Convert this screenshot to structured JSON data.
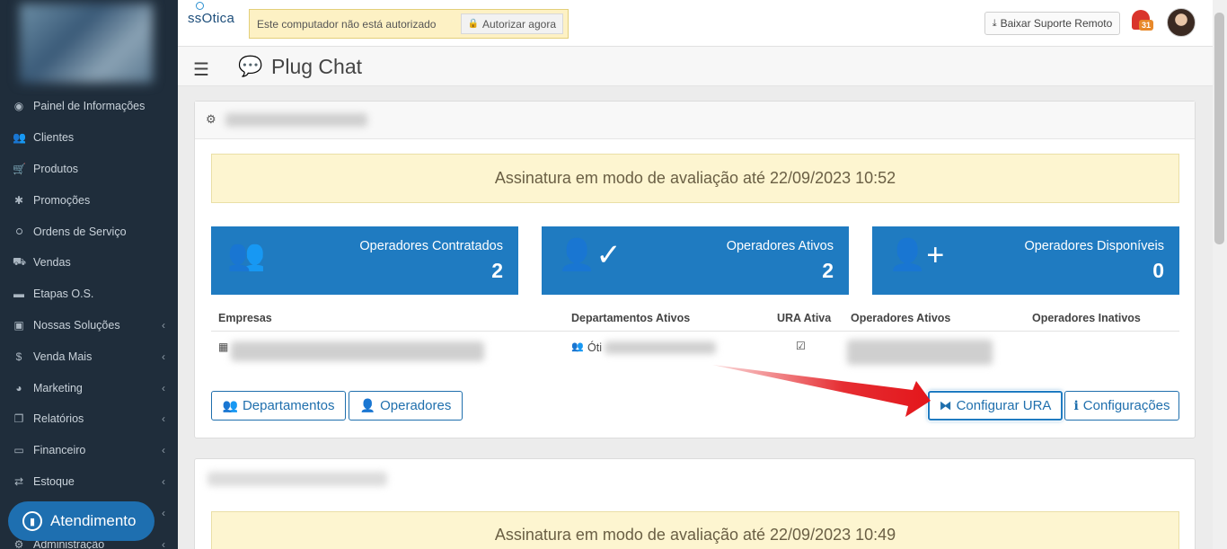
{
  "sidebar": {
    "items": [
      {
        "label": "Painel de Informações",
        "icon": "dashboard-icon",
        "glyph": "◉",
        "chevron": false
      },
      {
        "label": "Clientes",
        "icon": "users-icon",
        "glyph": "👥",
        "chevron": false
      },
      {
        "label": "Produtos",
        "icon": "cart-icon",
        "glyph": "🛒",
        "chevron": false
      },
      {
        "label": "Promoções",
        "icon": "asterisk-icon",
        "glyph": "✱",
        "chevron": false
      },
      {
        "label": "Ordens de Serviço",
        "icon": "glasses-icon",
        "glyph": "ഠ",
        "chevron": false
      },
      {
        "label": "Vendas",
        "icon": "basket-icon",
        "glyph": "⛟",
        "chevron": false
      },
      {
        "label": "Etapas O.S.",
        "icon": "steps-icon",
        "glyph": "▬",
        "chevron": false
      },
      {
        "label": "Nossas Soluções",
        "icon": "briefcase-icon",
        "glyph": "▣",
        "chevron": true
      },
      {
        "label": "Venda Mais",
        "icon": "dollar-icon",
        "glyph": "$",
        "chevron": true
      },
      {
        "label": "Marketing",
        "icon": "comments-icon",
        "glyph": "◕",
        "chevron": true
      },
      {
        "label": "Relatórios",
        "icon": "copy-icon",
        "glyph": "❐",
        "chevron": true
      },
      {
        "label": "Financeiro",
        "icon": "money-icon",
        "glyph": "▭",
        "chevron": true
      },
      {
        "label": "Estoque",
        "icon": "exchange-icon",
        "glyph": "⇄",
        "chevron": true
      },
      {
        "label": "",
        "icon": "hidden-icon",
        "glyph": "",
        "chevron": true
      },
      {
        "label": "Administração",
        "icon": "cog-icon",
        "glyph": "⚙",
        "chevron": true
      }
    ],
    "chevron_glyph": "‹",
    "atendimento_label": "Atendimento"
  },
  "topbar": {
    "brand": "ssOtica",
    "alert_text": "Este computador não está autorizado",
    "authorize_label": "Autorizar agora",
    "download_label": "Baixar Suporte Remoto",
    "notification_count": "31"
  },
  "page": {
    "title": "Plug Chat"
  },
  "card": {
    "trial_text": "Assinatura em modo de avaliação até 22/09/2023 10:52",
    "stats": [
      {
        "label": "Operadores Contratados",
        "value": "2",
        "icon": "users-group-icon"
      },
      {
        "label": "Operadores Ativos",
        "value": "2",
        "icon": "user-check-icon"
      },
      {
        "label": "Operadores Disponíveis",
        "value": "0",
        "icon": "user-plus-icon"
      }
    ],
    "table": {
      "headers": [
        "Empresas",
        "Departamentos Ativos",
        "URA Ativa",
        "Operadores Ativos",
        "Operadores Inativos"
      ],
      "row": {
        "departamento": "Óti"
      }
    },
    "buttons": {
      "departamentos": "Departamentos",
      "operadores": "Operadores",
      "configurar_ura": "Configurar URA",
      "configuracoes": "Configurações"
    }
  },
  "card2": {
    "trial_text": "Assinatura em modo de avaliação até 22/09/2023 10:49"
  },
  "colors": {
    "sidebar_bg": "#1f2d3b",
    "primary": "#1f7bc1",
    "trial_bg": "#fdf5d0",
    "arrow": "#e3161b"
  }
}
